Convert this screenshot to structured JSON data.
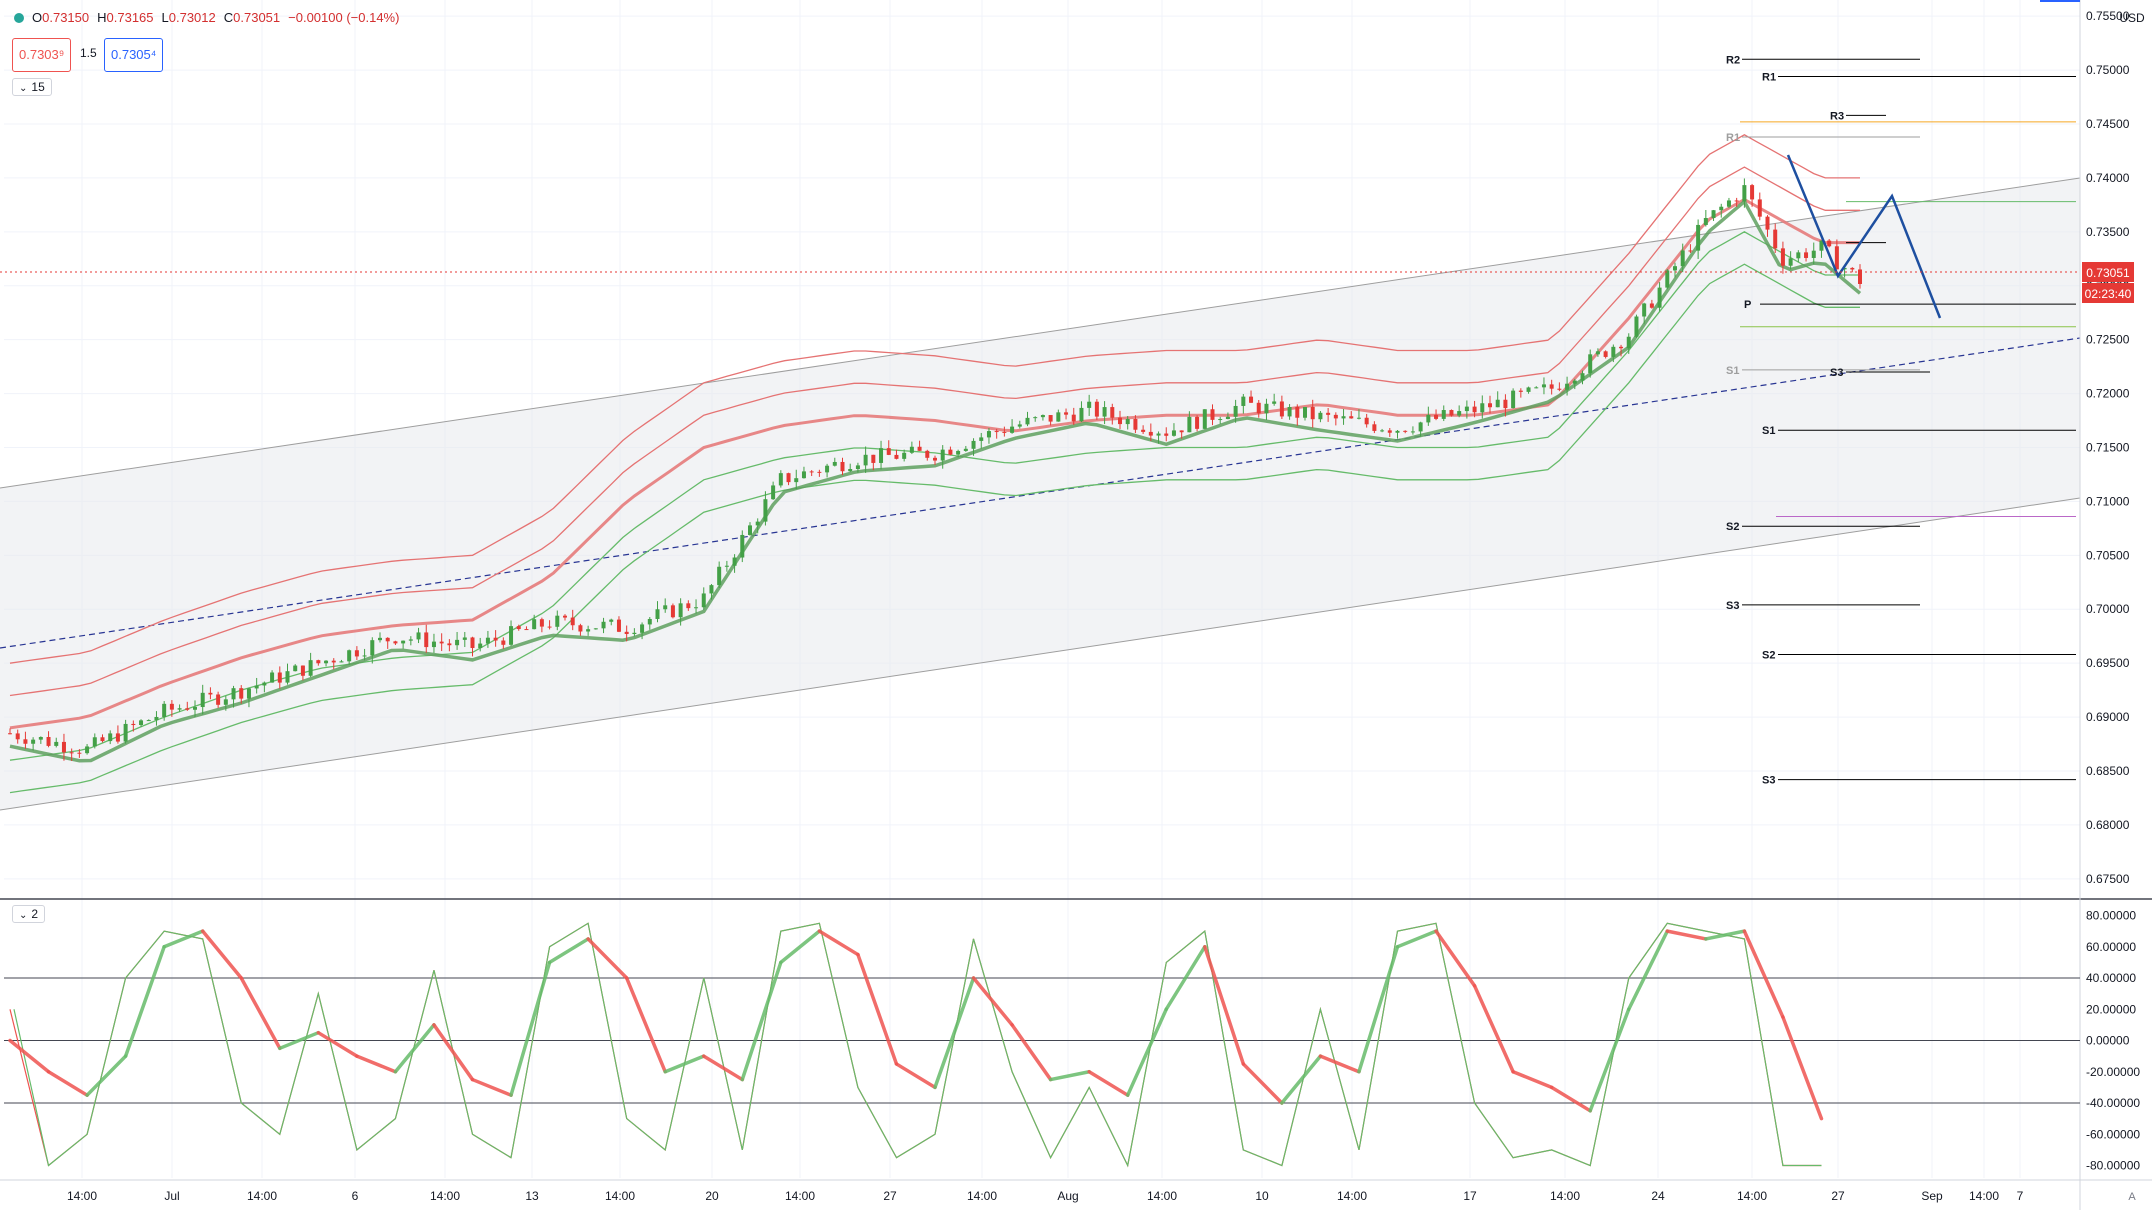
{
  "header": {
    "open_label": "O",
    "open": "0.73150",
    "high_label": "H",
    "high": "0.73165",
    "low_label": "L",
    "low": "0.73012",
    "close_label": "C",
    "close": "0.73051",
    "change": "−0.00100 (−0.14%)",
    "sell_price": "0.7303⁹",
    "spread": "1.5",
    "buy_price": "0.7305⁴"
  },
  "main_pane": {
    "indicator_count": "15"
  },
  "osc_pane": {
    "indicator_count": "2"
  },
  "currency": "USD",
  "last_price_label": "0.73051",
  "countdown_label": "02:23:40",
  "colors": {
    "bull": "#43a047",
    "bear": "#e53935",
    "band_red": "#e57373",
    "band_green": "#66bb6a",
    "channel": "#9e9e9e",
    "midline": "#283593",
    "pattern": "#1e4fa0"
  },
  "chart_data": [
    {
      "type": "line",
      "title": "",
      "instrument_currency": "USD",
      "price_axis": [
        "0.75500",
        "0.75000",
        "0.74500",
        "0.74000",
        "0.73500",
        "0.73000",
        "0.72500",
        "0.72000",
        "0.71500",
        "0.71000",
        "0.70500",
        "0.70000",
        "0.69500",
        "0.69000",
        "0.68500",
        "0.68000",
        "0.67500"
      ],
      "ylim": [
        0.6735,
        0.7565
      ],
      "time_axis": [
        "14:00",
        "Jul",
        "14:00",
        "6",
        "14:00",
        "13",
        "14:00",
        "20",
        "14:00",
        "27",
        "14:00",
        "Aug",
        "14:00",
        "10",
        "14:00",
        "17",
        "14:00",
        "24",
        "14:00",
        "27",
        "Sep",
        "7",
        "14:00"
      ],
      "series": [
        {
          "name": "",
          "x": [
            0,
            40,
            80,
            120,
            160,
            200,
            240,
            280,
            320,
            360,
            400,
            440,
            480,
            520,
            560,
            600,
            640,
            680,
            720,
            760,
            800,
            840,
            880,
            900,
            920,
            940,
            960
          ],
          "values": [
            0.6885,
            0.687,
            0.6905,
            0.6925,
            0.695,
            0.6975,
            0.6965,
            0.6988,
            0.6983,
            0.701,
            0.712,
            0.714,
            0.7145,
            0.717,
            0.7185,
            0.7165,
            0.719,
            0.7178,
            0.7168,
            0.7185,
            0.7205,
            0.7255,
            0.736,
            0.739,
            0.7325,
            0.7335,
            0.7305
          ]
        },
        {
          "name": "",
          "x": [
            0,
            40,
            80,
            120,
            160,
            200,
            240,
            280,
            320,
            360,
            400,
            440,
            480,
            520,
            560,
            600,
            640,
            680,
            720,
            760,
            800,
            840,
            880,
            900,
            920,
            940
          ],
          "values": [
            0.689,
            0.69,
            0.693,
            0.6955,
            0.6975,
            0.6985,
            0.699,
            0.703,
            0.71,
            0.715,
            0.717,
            0.718,
            0.7175,
            0.7165,
            0.7175,
            0.718,
            0.718,
            0.719,
            0.718,
            0.718,
            0.719,
            0.727,
            0.736,
            0.738,
            0.736,
            0.734
          ]
        }
      ],
      "levels": [
        {
          "label": "R2",
          "y": 0.751
        },
        {
          "label": "R1",
          "y": 0.7494
        },
        {
          "label": "R3",
          "y": 0.7458
        },
        {
          "label": "",
          "y": 0.7452
        },
        {
          "label": "R1",
          "y": 0.7438
        },
        {
          "label": "",
          "y": 0.7378
        },
        {
          "label": "",
          "y": 0.734
        },
        {
          "label": "P",
          "y": 0.7283
        },
        {
          "label": "",
          "y": 0.7262
        },
        {
          "label": "S1",
          "y": 0.7222
        },
        {
          "label": "S3",
          "y": 0.722
        },
        {
          "label": "S1",
          "y": 0.7166
        },
        {
          "label": "",
          "y": 0.7086
        },
        {
          "label": "S2",
          "y": 0.7077
        },
        {
          "label": "S3",
          "y": 0.7004
        },
        {
          "label": "S2",
          "y": 0.6958
        },
        {
          "label": "S3",
          "y": 0.6842
        }
      ]
    },
    {
      "type": "line",
      "title": "",
      "value_axis": [
        "80.00000",
        "60.00000",
        "40.00000",
        "20.00000",
        "0.00000",
        "-20.00000",
        "-40.00000",
        "-60.00000",
        "-80.00000"
      ],
      "ylim": [
        -88,
        88
      ],
      "reference_lines": [
        40,
        0,
        -40
      ],
      "series": [
        {
          "name": "",
          "x": [
            0,
            20,
            40,
            60,
            80,
            100,
            120,
            140,
            160,
            180,
            200,
            220,
            240,
            260,
            280,
            300,
            320,
            340,
            360,
            380,
            400,
            420,
            440,
            460,
            480,
            500,
            520,
            540,
            560,
            580,
            600,
            620,
            640,
            660,
            680,
            700,
            720,
            740,
            760,
            780,
            800,
            820,
            840,
            860,
            880,
            900,
            920,
            940
          ],
          "values": [
            0,
            -20,
            -35,
            -10,
            60,
            70,
            40,
            -5,
            5,
            -10,
            -20,
            10,
            -25,
            -35,
            50,
            65,
            40,
            -20,
            -10,
            -25,
            50,
            70,
            55,
            -15,
            -30,
            40,
            10,
            -25,
            -20,
            -35,
            20,
            60,
            -15,
            -40,
            -10,
            -20,
            60,
            70,
            35,
            -20,
            -30,
            -45,
            20,
            70,
            65,
            70,
            15,
            -50
          ]
        },
        {
          "name": "",
          "x": [
            0,
            20,
            40,
            60,
            80,
            100,
            120,
            140,
            160,
            180,
            200,
            220,
            240,
            260,
            280,
            300,
            320,
            340,
            360,
            380,
            400,
            420,
            440,
            460,
            480,
            500,
            520,
            540,
            560,
            580,
            600,
            620,
            640,
            660,
            680,
            700,
            720,
            740,
            760,
            780,
            800,
            820,
            840,
            860,
            880,
            900,
            920,
            940
          ],
          "values": [
            20,
            -80,
            -60,
            40,
            70,
            65,
            -40,
            -60,
            30,
            -70,
            -50,
            45,
            -60,
            -75,
            60,
            75,
            -50,
            -70,
            40,
            -70,
            70,
            75,
            -30,
            -75,
            -60,
            65,
            -20,
            -75,
            -30,
            -80,
            50,
            70,
            -70,
            -80,
            20,
            -70,
            70,
            75,
            -40,
            -75,
            -70,
            -80,
            40,
            75,
            70,
            65,
            -80,
            -80
          ]
        }
      ]
    }
  ]
}
